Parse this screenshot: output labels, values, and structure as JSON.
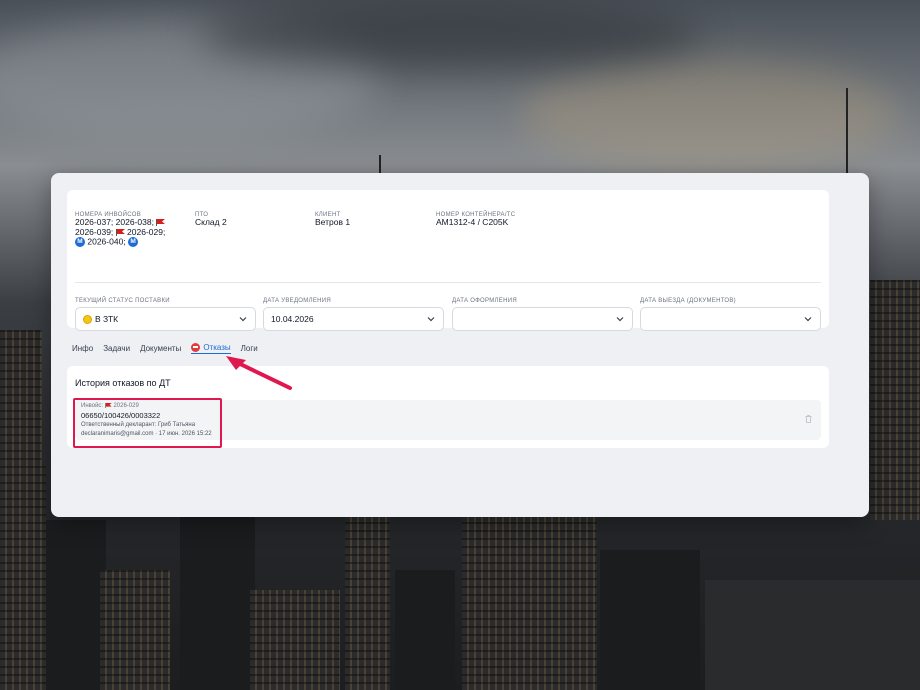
{
  "summary": {
    "invoices": {
      "label": "Номера инвойсов",
      "line1": "2026-037; 2026-038;",
      "line2a": "2026-039;",
      "line2b": "2026-029;",
      "line3": "2026-040;"
    },
    "pto": {
      "label": "ПТО",
      "value": "Склад 2"
    },
    "client": {
      "label": "Клиент",
      "value": "Ветров 1"
    },
    "container": {
      "label": "Номер контейнера/ТС",
      "value": "AM1312-4 / C205K"
    }
  },
  "fields": {
    "status": {
      "label": "Текущий статус поставки",
      "value": "В ЗТК"
    },
    "notify_date": {
      "label": "Дата уведомления",
      "value": "10.04.2026"
    },
    "clear_date": {
      "label": "Дата оформления",
      "value": ""
    },
    "exit_date": {
      "label": "Дата выезда (документов)",
      "value": ""
    }
  },
  "tabs": [
    {
      "label": "Инфо"
    },
    {
      "label": "Задачи"
    },
    {
      "label": "Документы"
    },
    {
      "label": "Отказы",
      "active": true
    },
    {
      "label": "Логи"
    }
  ],
  "history": {
    "title": "История отказов по ДТ",
    "entry": {
      "invoice_prefix": "Инвойс:",
      "invoice": "2026-029",
      "number": "06650/100426/0003322",
      "declarant": "Ответственный декларант: Гриб Татьяна",
      "meta": "declaranimaris@gmail.com · 17 июн. 2026 15:22"
    }
  },
  "colors": {
    "accent": "#1d6bd6",
    "highlight": "#e0174e",
    "flag": "#d62020",
    "status_coin": "#f5c518"
  },
  "icons": [
    "red-flag-icon",
    "metro-icon",
    "status-coin-icon",
    "chevron-down-icon",
    "refusal-icon",
    "trash-icon",
    "pointer-arrow-icon"
  ]
}
